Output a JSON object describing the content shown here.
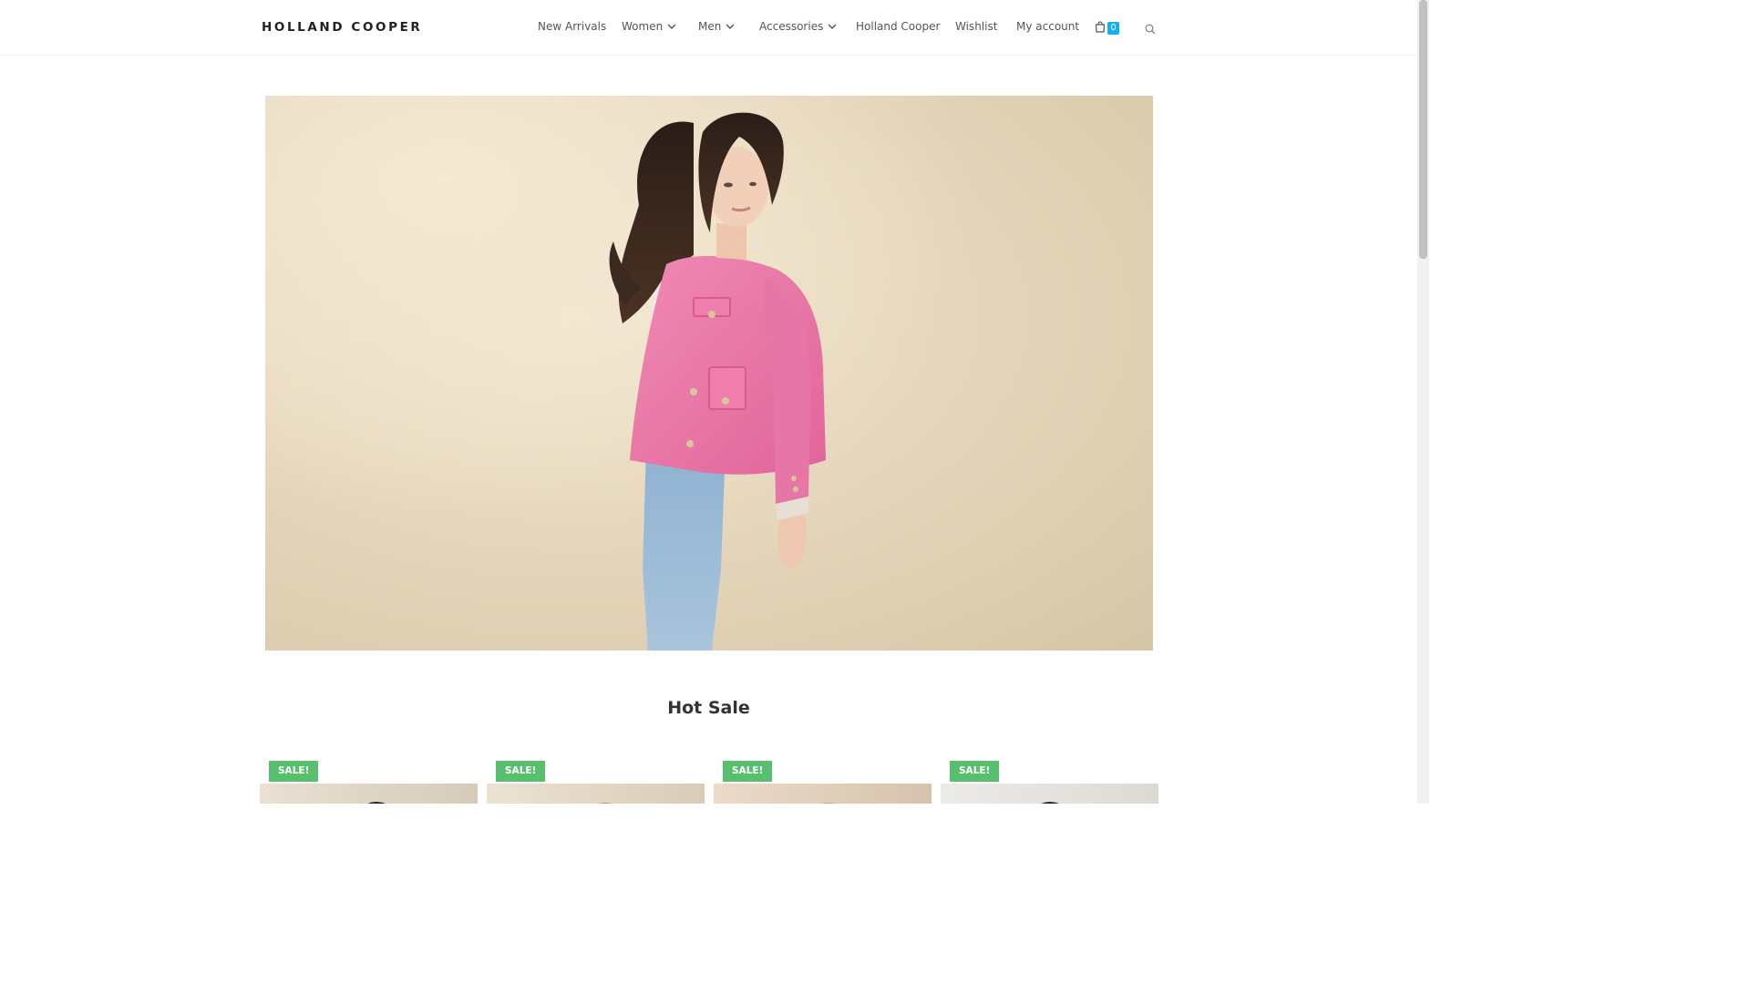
{
  "header": {
    "logo": "HOLLAND COOPER",
    "cart_count": "0"
  },
  "nav": {
    "items": [
      {
        "label": "New Arrivals",
        "dropdown": false
      },
      {
        "label": "Women",
        "dropdown": true
      },
      {
        "label": "Men",
        "dropdown": true
      },
      {
        "label": "Accessories",
        "dropdown": true
      },
      {
        "label": "Holland Cooper",
        "dropdown": false
      },
      {
        "label": "Wishlist",
        "dropdown": false
      },
      {
        "label": "My account",
        "dropdown": false
      }
    ]
  },
  "sections": {
    "hot_sale_title": "Hot Sale"
  },
  "products": [
    {
      "badge": "SALE!"
    },
    {
      "badge": "SALE!"
    },
    {
      "badge": "SALE!"
    },
    {
      "badge": "SALE!"
    }
  ],
  "colors": {
    "accent": "#13aff0",
    "sale_badge": "#57bf6d",
    "jacket": "#e96b9f"
  }
}
